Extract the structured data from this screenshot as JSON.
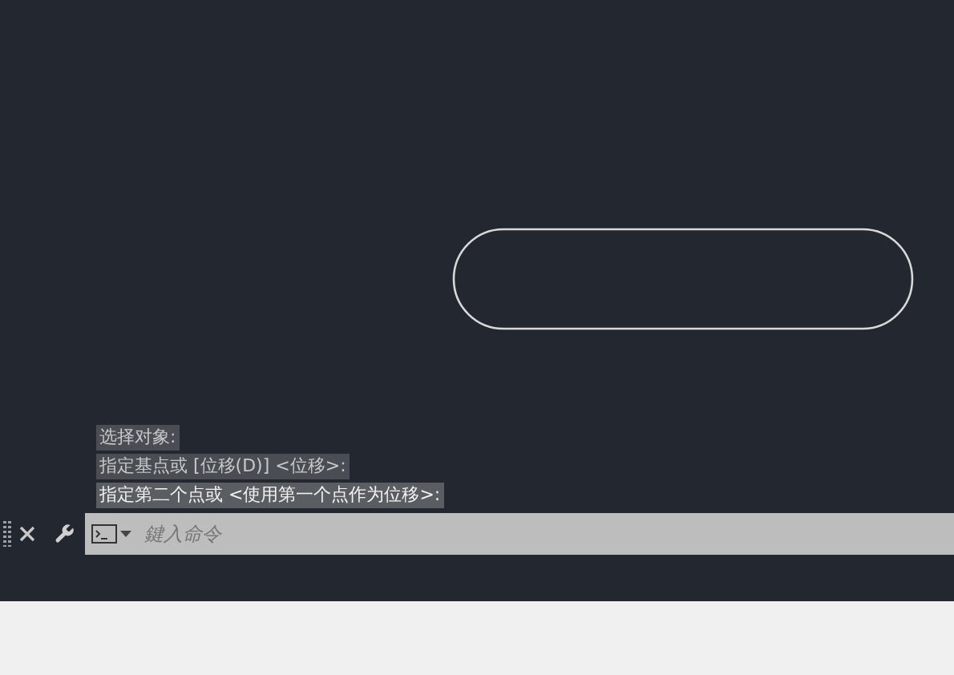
{
  "history": [
    {
      "text": "选择对象:",
      "current": false
    },
    {
      "text": "指定基点或 [位移(D)] <位移>:",
      "current": false
    },
    {
      "text": "指定第二个点或 <使用第一个点作为位移>:",
      "current": true
    }
  ],
  "command_line": {
    "placeholder": "鍵入命令"
  }
}
